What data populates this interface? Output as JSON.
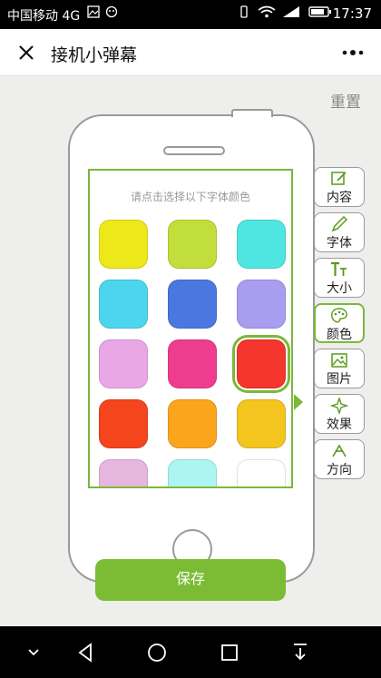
{
  "status": {
    "carrier": "中国移动 4G",
    "time": "17:37"
  },
  "header": {
    "title": "接机小弹幕"
  },
  "stage": {
    "reset_label": "重置",
    "hint": "请点击选择以下字体颜色",
    "selected_index": 8,
    "colors": [
      "#ede81a",
      "#c2de3b",
      "#4fe6e1",
      "#4dd5ee",
      "#4a78e0",
      "#a99df0",
      "#e9a7e6",
      "#ee3d8e",
      "#f4362c",
      "#f5451d",
      "#fba51c",
      "#f4c51f",
      "#e5b7de",
      "#aef5f2",
      "#ffffff"
    ]
  },
  "tabs": [
    {
      "label": "内容",
      "icon": "edit-content-icon"
    },
    {
      "label": "字体",
      "icon": "pencil-icon"
    },
    {
      "label": "大小",
      "icon": "text-size-icon"
    },
    {
      "label": "颜色",
      "icon": "palette-icon"
    },
    {
      "label": "图片",
      "icon": "image-icon"
    },
    {
      "label": "效果",
      "icon": "sparkle-icon"
    },
    {
      "label": "方向",
      "icon": "direction-icon"
    }
  ],
  "active_tab": 3,
  "save_label": "保存",
  "accent_color": "#7bbc34"
}
